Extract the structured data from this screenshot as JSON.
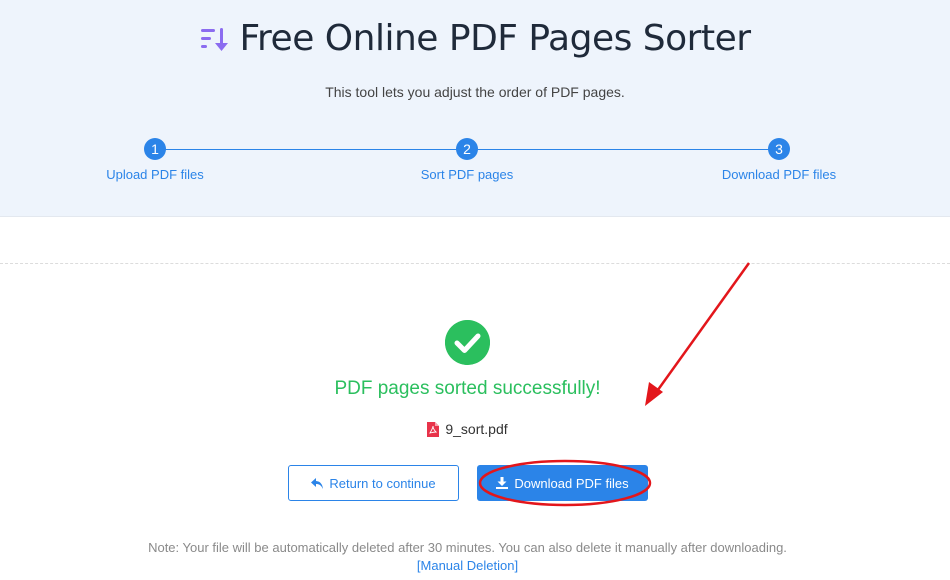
{
  "header": {
    "title": "Free Online PDF Pages Sorter",
    "subtitle": "This tool lets you adjust the order of PDF pages.",
    "title_icon": "sort-icon"
  },
  "steps": [
    {
      "number": "1",
      "label": "Upload PDF files"
    },
    {
      "number": "2",
      "label": "Sort PDF pages"
    },
    {
      "number": "3",
      "label": "Download PDF files"
    }
  ],
  "result": {
    "success_message": "PDF pages sorted successfully!",
    "file_name": "9_sort.pdf",
    "status_icon": "check-circle-icon",
    "file_icon": "pdf-file-icon"
  },
  "buttons": {
    "return_label": "Return to continue",
    "download_label": "Download PDF files"
  },
  "footer": {
    "note": "Note: Your file will be automatically deleted after 30 minutes. You can also delete it manually after downloading.",
    "manual_link": "[Manual Deletion]"
  },
  "colors": {
    "accent": "#2b84e8",
    "success": "#2bbf5e",
    "header_bg": "#eef4fc",
    "annotation": "#e3161b"
  }
}
